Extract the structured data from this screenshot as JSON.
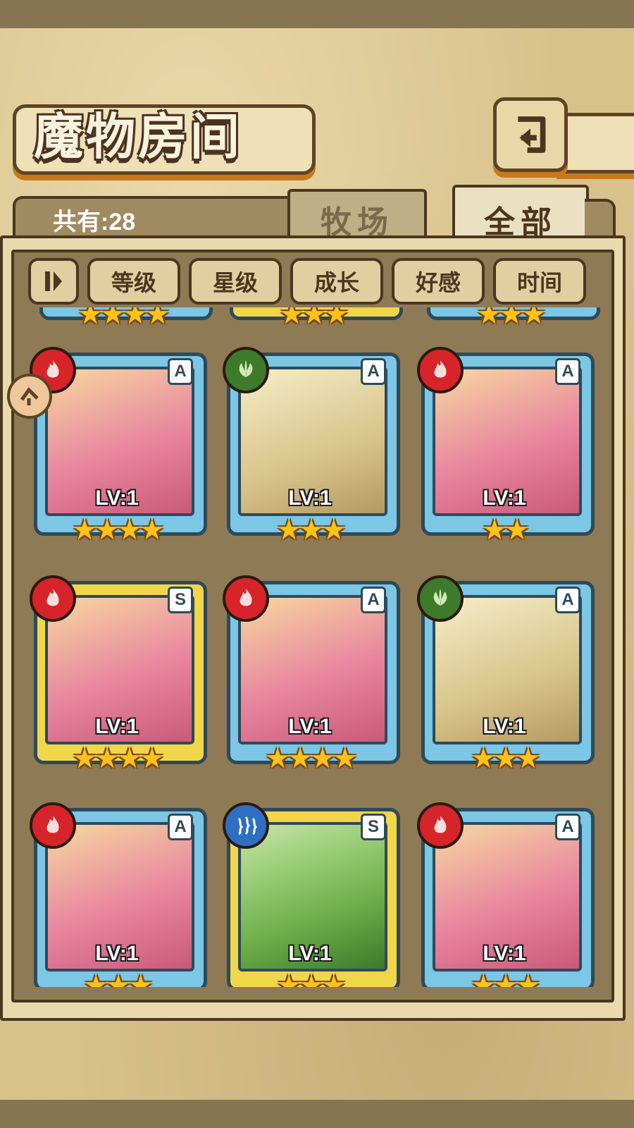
{
  "header": {
    "title": "魔物房间",
    "back_icon": "return-arrow-icon"
  },
  "summary": {
    "count_label": "共有:28"
  },
  "tabs": [
    {
      "label": "牧场",
      "active": false
    },
    {
      "label": "全部",
      "active": true
    }
  ],
  "sort": {
    "toggle_icon": "sort-direction-icon",
    "options": [
      "等级",
      "星级",
      "成长",
      "好感",
      "时间"
    ]
  },
  "colors": {
    "fire": "#d6242a",
    "wood": "#3d7a2a",
    "water": "#2f6fc2",
    "frame_blue": "#7cc6e6",
    "frame_gold": "#f2d64a"
  },
  "monsters": [
    {
      "element": "fire",
      "rank": "A",
      "level": "LV:1",
      "stars": "★★★★",
      "frame": "blue"
    },
    {
      "element": "wood",
      "rank": "A",
      "level": "LV:1",
      "stars": "★★★",
      "frame": "blue"
    },
    {
      "element": "fire",
      "rank": "A",
      "level": "LV:1",
      "stars": "★★",
      "frame": "blue"
    },
    {
      "element": "fire",
      "rank": "S",
      "level": "LV:1",
      "stars": "★★★★",
      "frame": "gold"
    },
    {
      "element": "fire",
      "rank": "A",
      "level": "LV:1",
      "stars": "★★★★",
      "frame": "blue"
    },
    {
      "element": "wood",
      "rank": "A",
      "level": "LV:1",
      "stars": "★★★",
      "frame": "blue"
    },
    {
      "element": "fire",
      "rank": "A",
      "level": "LV:1",
      "stars": "★★★",
      "frame": "blue"
    },
    {
      "element": "water",
      "rank": "S",
      "level": "LV:1",
      "stars": "★★★",
      "frame": "gold"
    },
    {
      "element": "fire",
      "rank": "A",
      "level": "LV:1",
      "stars": "★★★",
      "frame": "blue"
    }
  ],
  "top_partial_stars": [
    "★★★★",
    "★★★",
    "★★★"
  ]
}
